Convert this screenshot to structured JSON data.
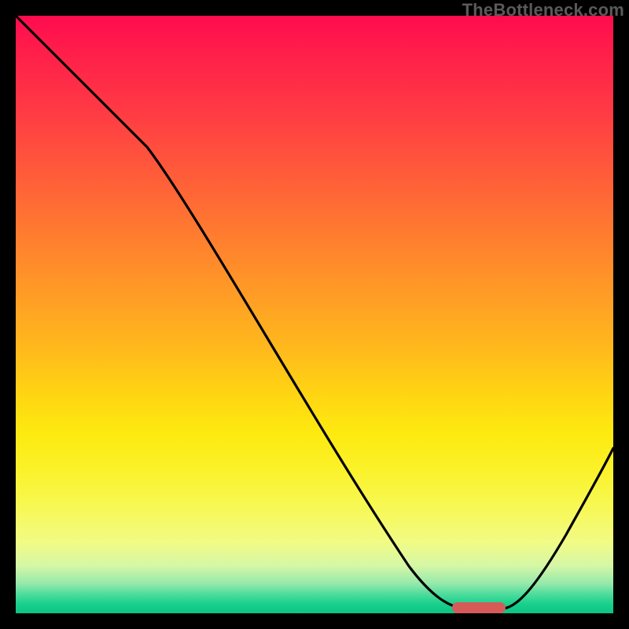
{
  "watermark": "TheBottleneck.com",
  "chart_data": {
    "type": "line",
    "title": "",
    "xlabel": "",
    "ylabel": "",
    "xlim": [
      0,
      100
    ],
    "ylim": [
      0,
      100
    ],
    "grid": false,
    "legend": false,
    "series": [
      {
        "name": "bottleneck-curve",
        "x": [
          0,
          10,
          22,
          35,
          48,
          60,
          70,
          74,
          78,
          82,
          90,
          100
        ],
        "values": [
          100,
          90,
          78,
          58,
          38,
          20,
          6,
          1,
          0.5,
          1,
          12,
          28
        ]
      }
    ],
    "marker": {
      "name": "optimal-range",
      "x_start": 73,
      "x_end": 81,
      "y": 0.8,
      "color": "#d65b58"
    },
    "background_gradient": {
      "direction": "vertical",
      "stops": [
        {
          "pos": 0,
          "color": "#ff0b4f"
        },
        {
          "pos": 50,
          "color": "#ff9a26"
        },
        {
          "pos": 75,
          "color": "#fdea10"
        },
        {
          "pos": 100,
          "color": "#0cc583"
        }
      ]
    }
  }
}
